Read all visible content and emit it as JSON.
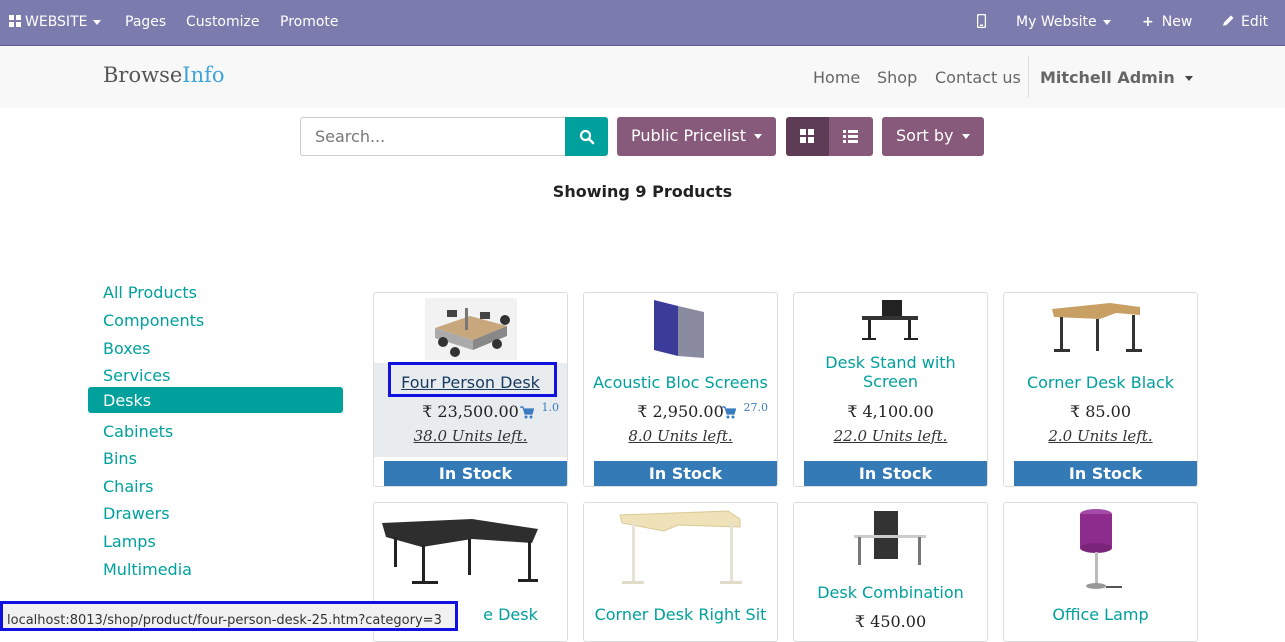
{
  "topbar": {
    "website_label": "WEBSITE",
    "pages": "Pages",
    "customize": "Customize",
    "promote": "Promote",
    "my_website": "My Website",
    "new": "New",
    "edit": "Edit"
  },
  "header": {
    "logo_part1": "Browse",
    "logo_part2": "Info",
    "nav": [
      "Home",
      "Shop",
      "Contact us"
    ],
    "user": "Mitchell Admin"
  },
  "toolbar": {
    "search_placeholder": "Search...",
    "pricelist": "Public Pricelist",
    "sort": "Sort by"
  },
  "showing": "Showing 9 Products",
  "categories": [
    {
      "label": "All Products",
      "active": false
    },
    {
      "label": "Components",
      "active": false
    },
    {
      "label": "Boxes",
      "active": false
    },
    {
      "label": "Services",
      "active": false
    },
    {
      "label": "Desks",
      "active": true
    },
    {
      "label": "Cabinets",
      "active": false
    },
    {
      "label": "Bins",
      "active": false
    },
    {
      "label": "Chairs",
      "active": false
    },
    {
      "label": "Drawers",
      "active": false
    },
    {
      "label": "Lamps",
      "active": false
    },
    {
      "label": "Multimedia",
      "active": false
    }
  ],
  "products": [
    {
      "name": "Four Person Desk",
      "price": "₹ 23,500.00",
      "cart_qty": "1.0",
      "units": "38.0 Units left.",
      "stock": "In Stock"
    },
    {
      "name": "Acoustic Bloc Screens",
      "price": "₹ 2,950.00",
      "cart_qty": "27.0",
      "units": "8.0 Units left.",
      "stock": "In Stock"
    },
    {
      "name_line1": "Desk Stand with",
      "name_line2": "Screen",
      "price": "₹ 4,100.00",
      "units": "22.0 Units left.",
      "stock": "In Stock"
    },
    {
      "name": "Corner Desk Black",
      "price": "₹ 85.00",
      "units": "2.0 Units left.",
      "stock": "In Stock"
    },
    {
      "name_partial": "e Desk"
    },
    {
      "name": "Corner Desk Right Sit"
    },
    {
      "name": "Desk Combination",
      "price": "₹ 450.00"
    },
    {
      "name": "Office Lamp"
    }
  ],
  "status_url": "localhost:8013/shop/product/four-person-desk-25.htm?category=3"
}
